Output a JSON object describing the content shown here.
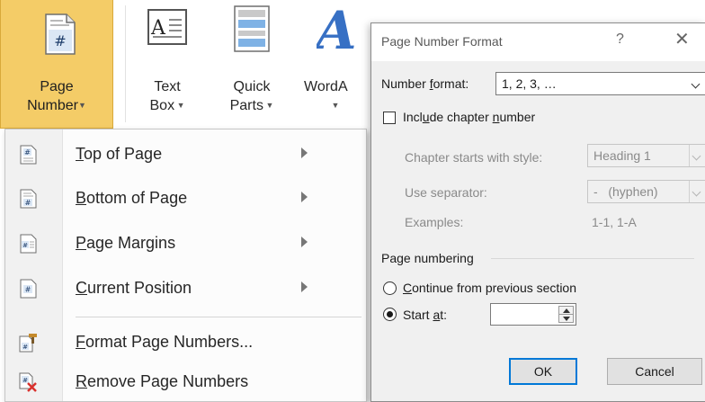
{
  "ribbon": {
    "page_number": {
      "line1": "Page",
      "line2": "Number"
    },
    "text_box": {
      "line1": "Text",
      "line2": "Box"
    },
    "quick_parts": {
      "line1": "Quick",
      "line2": "Parts"
    },
    "wordart": {
      "line1": "WordA"
    },
    "active_color": "#f4cc67"
  },
  "menu": {
    "items": [
      {
        "pre": "",
        "key": "T",
        "post": "op of Page",
        "submenu": true
      },
      {
        "pre": "",
        "key": "B",
        "post": "ottom of Page",
        "submenu": true
      },
      {
        "pre": "",
        "key": "P",
        "post": "age Margins",
        "submenu": true
      },
      {
        "pre": "",
        "key": "C",
        "post": "urrent Position",
        "submenu": true
      },
      {
        "pre": "",
        "key": "F",
        "post": "ormat Page Numbers...",
        "submenu": false
      },
      {
        "pre": "",
        "key": "R",
        "post": "emove Page Numbers",
        "submenu": false
      }
    ]
  },
  "dialog": {
    "title": "Page Number Format",
    "help": "?",
    "close": "✕",
    "number_format": {
      "label_pre": "Number ",
      "label_key": "f",
      "label_post": "ormat:",
      "value": "1, 2, 3, …"
    },
    "include_chapter": {
      "pre": "Incl",
      "key": "u",
      "post": "de chapter ",
      "key2": "n",
      "post2": "umber",
      "checked": false
    },
    "chapter_style": {
      "label": "Chapter starts with style:",
      "value": "Heading 1"
    },
    "separator": {
      "label": "Use separator:",
      "value": "-   (hyphen)"
    },
    "examples": {
      "label": "Examples:",
      "value": "1-1, 1-A"
    },
    "page_numbering": {
      "label": "Page numbering"
    },
    "continue": {
      "key": "C",
      "post": "ontinue from previous section",
      "selected": false
    },
    "start_at": {
      "pre": "Start ",
      "key": "a",
      "post": "t:",
      "selected": true,
      "value": ""
    },
    "ok": "OK",
    "cancel": "Cancel"
  }
}
